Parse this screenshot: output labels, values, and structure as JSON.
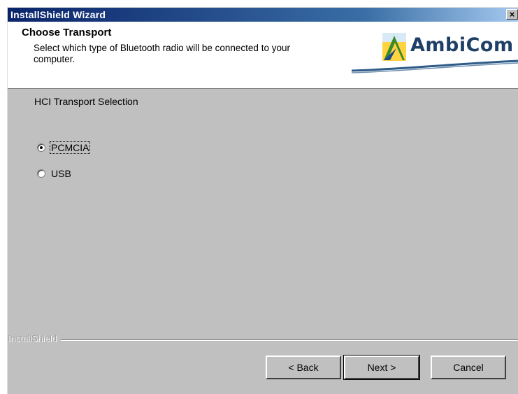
{
  "window": {
    "title": "InstallShield Wizard",
    "close_glyph": "×"
  },
  "header": {
    "title": "Choose Transport",
    "description": "Select which type of Bluetooth radio will be connected to your computer.",
    "logo_text": "AmbiCom",
    "logo_icon": "ambicom-logo-icon"
  },
  "content": {
    "section_label": "HCI Transport Selection",
    "options": [
      {
        "label": "PCMCIA",
        "selected": true
      },
      {
        "label": "USB",
        "selected": false
      }
    ]
  },
  "footer": {
    "brand": "InstallShield",
    "back_label": "< Back",
    "next_label": "Next >",
    "cancel_label": "Cancel"
  },
  "colors": {
    "title_bar": "#0a246a",
    "face": "#c0c0c0",
    "logo_blue": "#1e3f66"
  }
}
